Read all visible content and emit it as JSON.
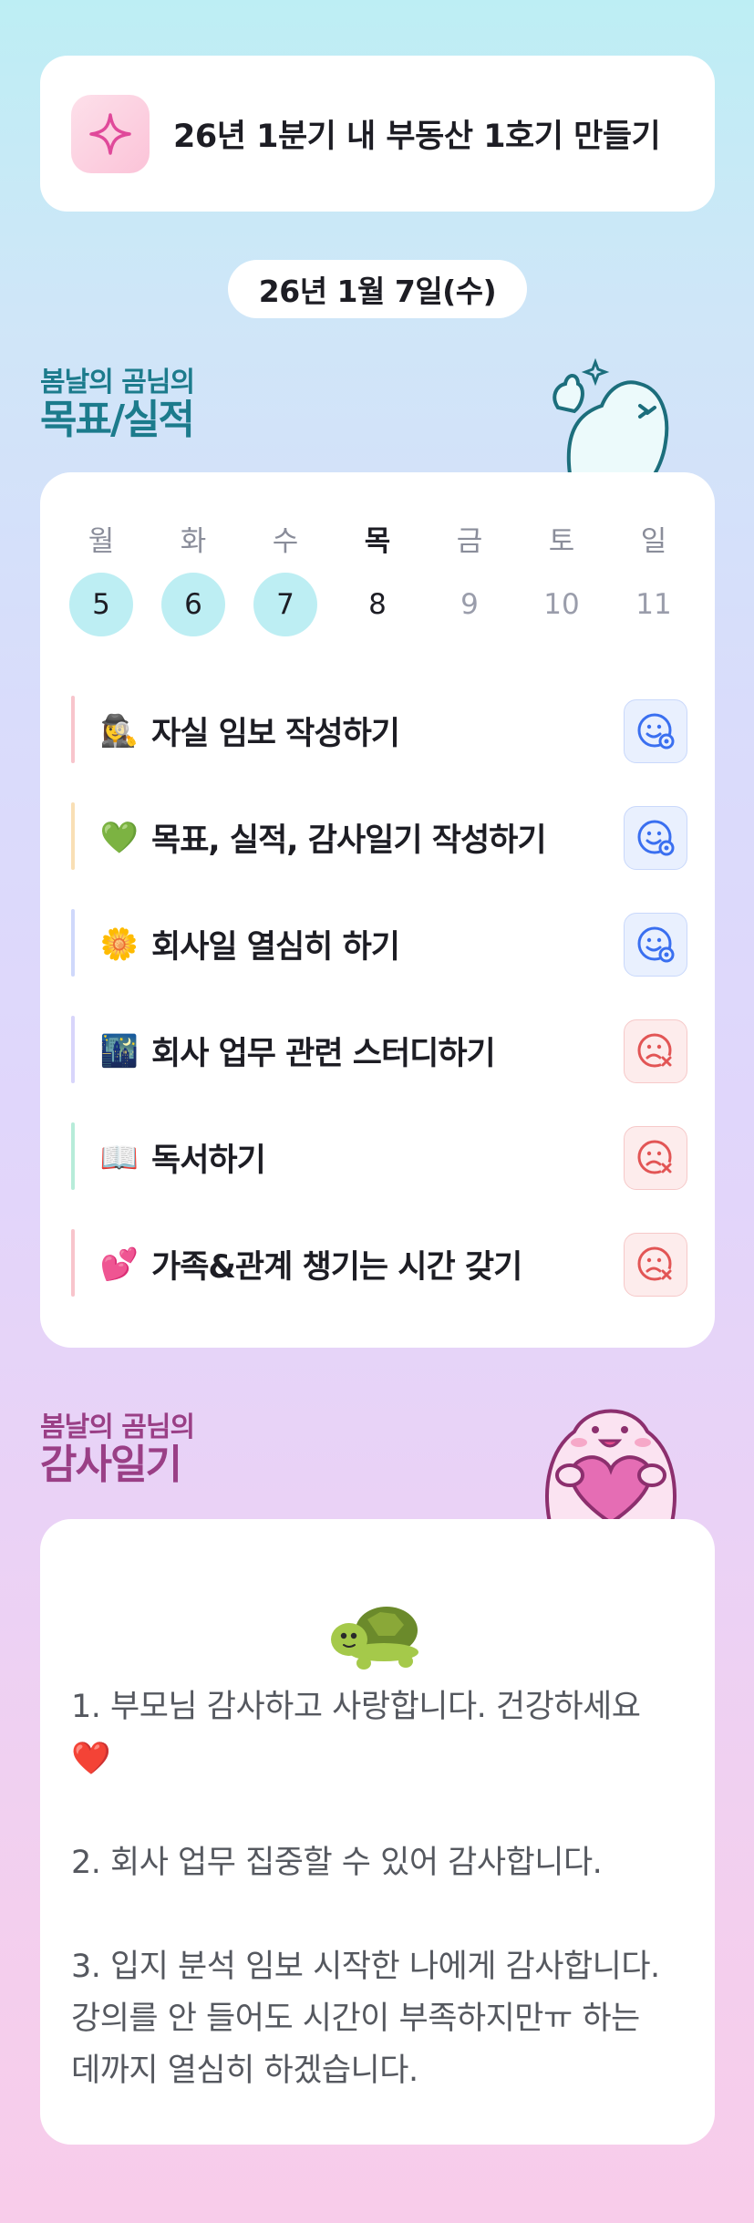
{
  "goal": {
    "icon": "sparkle-icon",
    "text": "26년 1분기 내 부동산 1호기 만들기"
  },
  "date": "26년 1월 7일(수)",
  "goal_section": {
    "subtitle": "봄날의 곰님의",
    "title": "목표/실적"
  },
  "week": [
    {
      "label": "월",
      "num": "5",
      "state": "done"
    },
    {
      "label": "화",
      "num": "6",
      "state": "done"
    },
    {
      "label": "수",
      "num": "7",
      "state": "done"
    },
    {
      "label": "목",
      "num": "8",
      "state": "today"
    },
    {
      "label": "금",
      "num": "9",
      "state": "future"
    },
    {
      "label": "토",
      "num": "10",
      "state": "future"
    },
    {
      "label": "일",
      "num": "11",
      "state": "future"
    }
  ],
  "tasks": [
    {
      "emoji": "🕵️‍♀️",
      "label": "자실 임보 작성하기",
      "status": "achieved",
      "status_icon": "smile-check-icon",
      "bar_color": "#f8c5cc"
    },
    {
      "emoji": "💚",
      "label": "목표, 실적, 감사일기 작성하기",
      "status": "achieved",
      "status_icon": "smile-check-icon",
      "bar_color": "#f9dfb5"
    },
    {
      "emoji": "🌼",
      "label": "회사일 열심히 하기",
      "status": "achieved",
      "status_icon": "smile-check-icon",
      "bar_color": "#cfd8fb"
    },
    {
      "emoji": "🌃",
      "label": "회사 업무 관련 스터디하기",
      "status": "missed",
      "status_icon": "sad-x-icon",
      "bar_color": "#d8d5fb"
    },
    {
      "emoji": "📖",
      "label": "독서하기",
      "status": "missed",
      "status_icon": "sad-x-icon",
      "bar_color": "#b7ecd9"
    },
    {
      "emoji": "💕",
      "label": "가족&관계 챙기는 시간 갖기",
      "status": "missed",
      "status_icon": "sad-x-icon",
      "bar_color": "#f8c5cc"
    }
  ],
  "thanks_section": {
    "subtitle": "봄날의 곰님의",
    "title": "감사일기"
  },
  "thanks": {
    "emoji": "turtle-icon",
    "text": "1. 부모님 감사하고 사랑합니다. 건강하세요❤️\n\n2. 회사 업무 집중할 수 있어 감사합니다.\n\n3. 입지 분석 임보 시작한 나에게 감사합니다. 강의를 안 들어도 시간이 부족하지만ㅠ 하는 데까지 열심히 하겠습니다."
  },
  "colors": {
    "achieved": "#3a6ff0",
    "missed": "#e25555",
    "done_circle": "#bdeef3"
  }
}
